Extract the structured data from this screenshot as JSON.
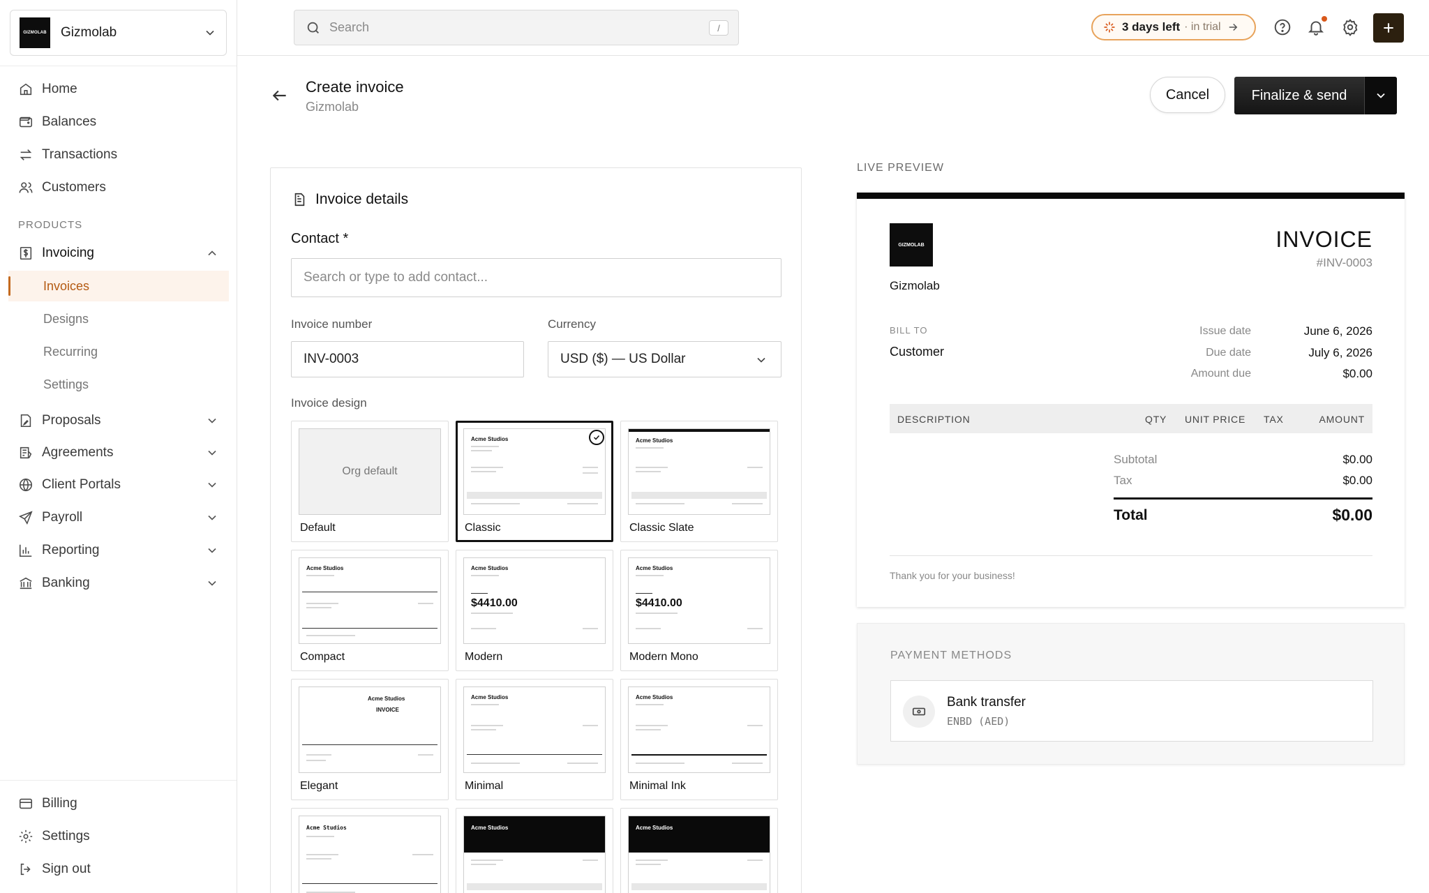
{
  "org": {
    "name": "Gizmolab",
    "logo_text": "GIZMOLAB"
  },
  "nav": {
    "main": [
      {
        "label": "Home",
        "icon": "home-icon"
      },
      {
        "label": "Balances",
        "icon": "wallet-icon"
      },
      {
        "label": "Transactions",
        "icon": "transfer-icon"
      },
      {
        "label": "Customers",
        "icon": "users-icon"
      }
    ],
    "section_label": "PRODUCTS",
    "invoicing": {
      "label": "Invoicing",
      "expanded": true
    },
    "invoicing_sub": [
      {
        "label": "Invoices",
        "active": true
      },
      {
        "label": "Designs"
      },
      {
        "label": "Recurring"
      },
      {
        "label": "Settings"
      }
    ],
    "products": [
      {
        "label": "Proposals",
        "icon": "proposal-icon"
      },
      {
        "label": "Agreements",
        "icon": "agreement-icon"
      },
      {
        "label": "Client Portals",
        "icon": "globe-icon"
      },
      {
        "label": "Payroll",
        "icon": "send-icon"
      },
      {
        "label": "Reporting",
        "icon": "bar-chart-icon"
      },
      {
        "label": "Banking",
        "icon": "bank-icon"
      }
    ],
    "bottom": [
      {
        "label": "Billing",
        "icon": "card-icon"
      },
      {
        "label": "Settings",
        "icon": "gear-icon"
      },
      {
        "label": "Sign out",
        "icon": "sign-out-icon"
      }
    ]
  },
  "topbar": {
    "search_placeholder": "Search",
    "shortcut": "/",
    "trial_days": "3 days left",
    "trial_suffix": "· in trial",
    "accent": "#e8a35b"
  },
  "header": {
    "title": "Create invoice",
    "subtitle": "Gizmolab",
    "cancel_label": "Cancel",
    "finalize_label": "Finalize & send"
  },
  "form": {
    "card_title": "Invoice details",
    "contact_label": "Contact *",
    "contact_placeholder": "Search or type to add contact...",
    "invoice_number_label": "Invoice number",
    "invoice_number_value": "INV-0003",
    "currency_label": "Currency",
    "currency_value": "USD ($) — US Dollar",
    "design_label": "Invoice design"
  },
  "designs": [
    {
      "name": "Default",
      "org_default": "Org default"
    },
    {
      "name": "Classic",
      "selected": true
    },
    {
      "name": "Classic Slate"
    },
    {
      "name": "Compact"
    },
    {
      "name": "Modern"
    },
    {
      "name": "Modern Mono"
    },
    {
      "name": "Elegant"
    },
    {
      "name": "Minimal"
    },
    {
      "name": "Minimal Ink"
    },
    {
      "name": ""
    },
    {
      "name": ""
    },
    {
      "name": ""
    }
  ],
  "thumb": {
    "studio": "Acme Studios",
    "studio_mono": "Acme Studios",
    "amount": "$4410.00",
    "invoice_word": "INVOICE"
  },
  "preview": {
    "label": "LIVE PREVIEW",
    "org": "Gizmolab",
    "logo_text": "GIZMOLAB",
    "title": "INVOICE",
    "number": "#INV-0003",
    "bill_to_label": "BILL TO",
    "customer": "Customer",
    "issue_date_label": "Issue date",
    "issue_date": "June 6, 2026",
    "due_date_label": "Due date",
    "due_date": "July 6, 2026",
    "amount_due_label": "Amount due",
    "amount_due": "$0.00",
    "columns": [
      "DESCRIPTION",
      "QTY",
      "UNIT PRICE",
      "TAX",
      "AMOUNT"
    ],
    "subtotal_label": "Subtotal",
    "subtotal": "$0.00",
    "tax_label": "Tax",
    "tax": "$0.00",
    "total_label": "Total",
    "total": "$0.00",
    "thanks": "Thank you for your business!"
  },
  "payment": {
    "label": "PAYMENT METHODS",
    "method": "Bank transfer",
    "account": "ENBD (AED)"
  }
}
